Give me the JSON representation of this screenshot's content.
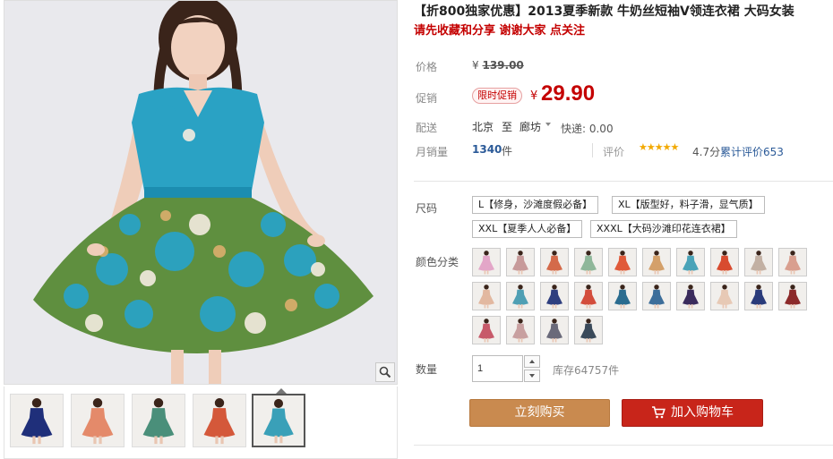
{
  "product": {
    "title": "【折800独家优惠】2013夏季新款 牛奶丝短袖V领连衣裙 大码女装",
    "subtitle": "请先收藏和分享 谢谢大家 点关注"
  },
  "price": {
    "label": "价格",
    "currency": "¥",
    "original": "139.00"
  },
  "promo": {
    "label": "促销",
    "badge": "限时促销",
    "currency": "¥",
    "price": "29.90"
  },
  "shipping": {
    "label": "配送",
    "from": "北京",
    "to_word": "至",
    "to_city": "廊坊",
    "fee": "快递: 0.00"
  },
  "sales": {
    "label": "月销量",
    "count": "1340",
    "unit": "件"
  },
  "rating": {
    "label": "评价",
    "stars": "★★★★★",
    "score": "4.7分",
    "reviews": "累计评价653"
  },
  "size": {
    "label": "尺码",
    "options": [
      "L【修身，沙滩度假必备】",
      "XL【版型好，料子滑，显气质】",
      "XXL【夏季人人必备】",
      "XXXL【大码沙滩印花连衣裙】"
    ]
  },
  "color": {
    "label": "颜色分类",
    "swatches": [
      "#e3a6c8",
      "#c79a9a",
      "#d46a4a",
      "#8fb79a",
      "#e05a3a",
      "#d4a06a",
      "#4aa3b8",
      "#d84b2f",
      "#c2b0a3",
      "#d99f8f",
      "#e2b8a0",
      "#4f9fb4",
      "#2f3f7f",
      "#d34d3c",
      "#2b6c8f",
      "#3d6e9a",
      "#3a2b5c",
      "#e7c9b5",
      "#2a3b7a",
      "#8c2a2a",
      "#c75a6a",
      "#c8a0a0",
      "#6a6a7a",
      "#3a4a5a"
    ]
  },
  "quantity": {
    "label": "数量",
    "value": "1",
    "stock": "库存64757件"
  },
  "actions": {
    "buy_now": "立刻购买",
    "add_to_cart": "加入购物车"
  },
  "gallery": {
    "thumbnail_colors": [
      "#1f2f7a",
      "#e48a6a",
      "#4a8f7a",
      "#d4583a",
      "#3aa0b8"
    ],
    "selected_index": 4
  },
  "colors": {
    "accent_red": "#c40000",
    "buy_button": "#c98a4f",
    "cart_button": "#c8251a",
    "link_blue": "#2b5a98"
  }
}
